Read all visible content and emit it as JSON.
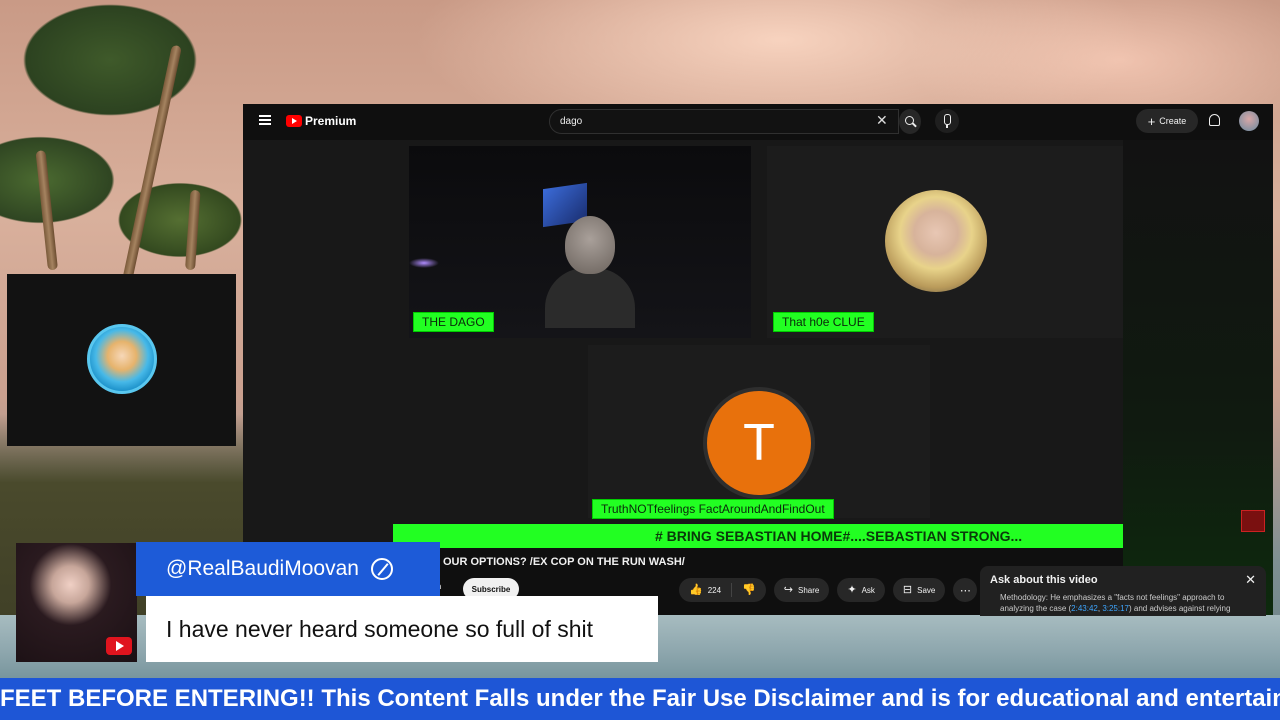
{
  "youtube": {
    "logo_text": "Premium",
    "search_value": "dago",
    "create_label": "Create",
    "participants": [
      {
        "name": "THE DAGO"
      },
      {
        "name": "That h0e CLUE"
      },
      {
        "name": "TruthNOTfeelings FactAroundAndFindOut",
        "initial": "T"
      }
    ],
    "banner": "# BRING SEBASTIAN HOME#....SEBASTIAN STRONG...",
    "video_title": "OUR OPTIONS? /EX COP ON THE RUN WASH/",
    "join_fragment": "in",
    "subscribe_label": "Subscribe",
    "like_count": "224",
    "share_label": "Share",
    "ask_label": "Ask",
    "save_label": "Save",
    "ask_panel": {
      "title": "Ask about this video",
      "text_prefix": "Methodology: He emphasizes a \"facts not feelings\" approach to analyzing the case (",
      "ts1": "2:43:42",
      "text_mid": ", ",
      "ts2": "3:25:17",
      "text_suffix": ") and advises against relying"
    }
  },
  "chat": {
    "username": "@RealBaudiMoovan",
    "message": "I have never heard someone so full of shit"
  },
  "ticker": {
    "text": "FEET BEFORE ENTERING!! This Content Falls under the Fair Use Disclaimer and is for educational and entertainment"
  },
  "colors": {
    "accent_green": "#22ff22",
    "chat_blue": "#1d5bd8",
    "ticker_blue": "#1e56d6",
    "avatar_orange": "#e8710c"
  }
}
